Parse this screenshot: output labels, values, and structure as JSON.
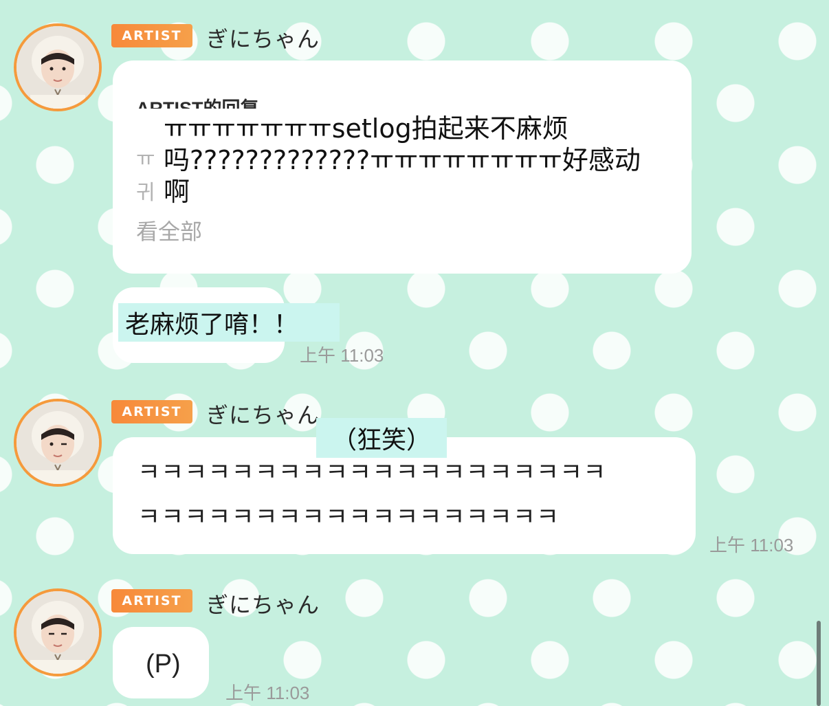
{
  "messages": [
    {
      "badge": "ARTIST",
      "sender": "ぎにちゃん",
      "reply_header": "ARTIST的回复",
      "reply_ghost_1": "ㅠ",
      "reply_ghost_2": "귀",
      "reply_text": "ㅠㅠㅠㅠㅠㅠㅠsetlog拍起来不麻烦吗?????????????ㅠㅠㅠㅠㅠㅠㅠㅠ好感动啊",
      "see_all": "看全部",
      "message": "老麻烦了唷！！",
      "time": "上午 11:03"
    },
    {
      "badge": "ARTIST",
      "sender": "ぎにちゃん",
      "annotation": "（狂笑）",
      "line1": "ㅋㅋㅋㅋㅋㅋㅋㅋㅋㅋㅋㅋㅋㅋㅋㅋㅋㅋㅋㅋ",
      "line2": "ㅋㅋㅋㅋㅋㅋㅋㅋㅋㅋㅋㅋㅋㅋㅋㅋㅋㅋ",
      "time": "上午 11:03"
    },
    {
      "badge": "ARTIST",
      "sender": "ぎにちゃん",
      "message": "(P)",
      "time": "上午 11:03"
    }
  ],
  "icons": {
    "avatar": "avatar-icon"
  },
  "colors": {
    "badge": "#f7893a",
    "background": "#c6f0df",
    "highlight": "#cbf5ef"
  }
}
